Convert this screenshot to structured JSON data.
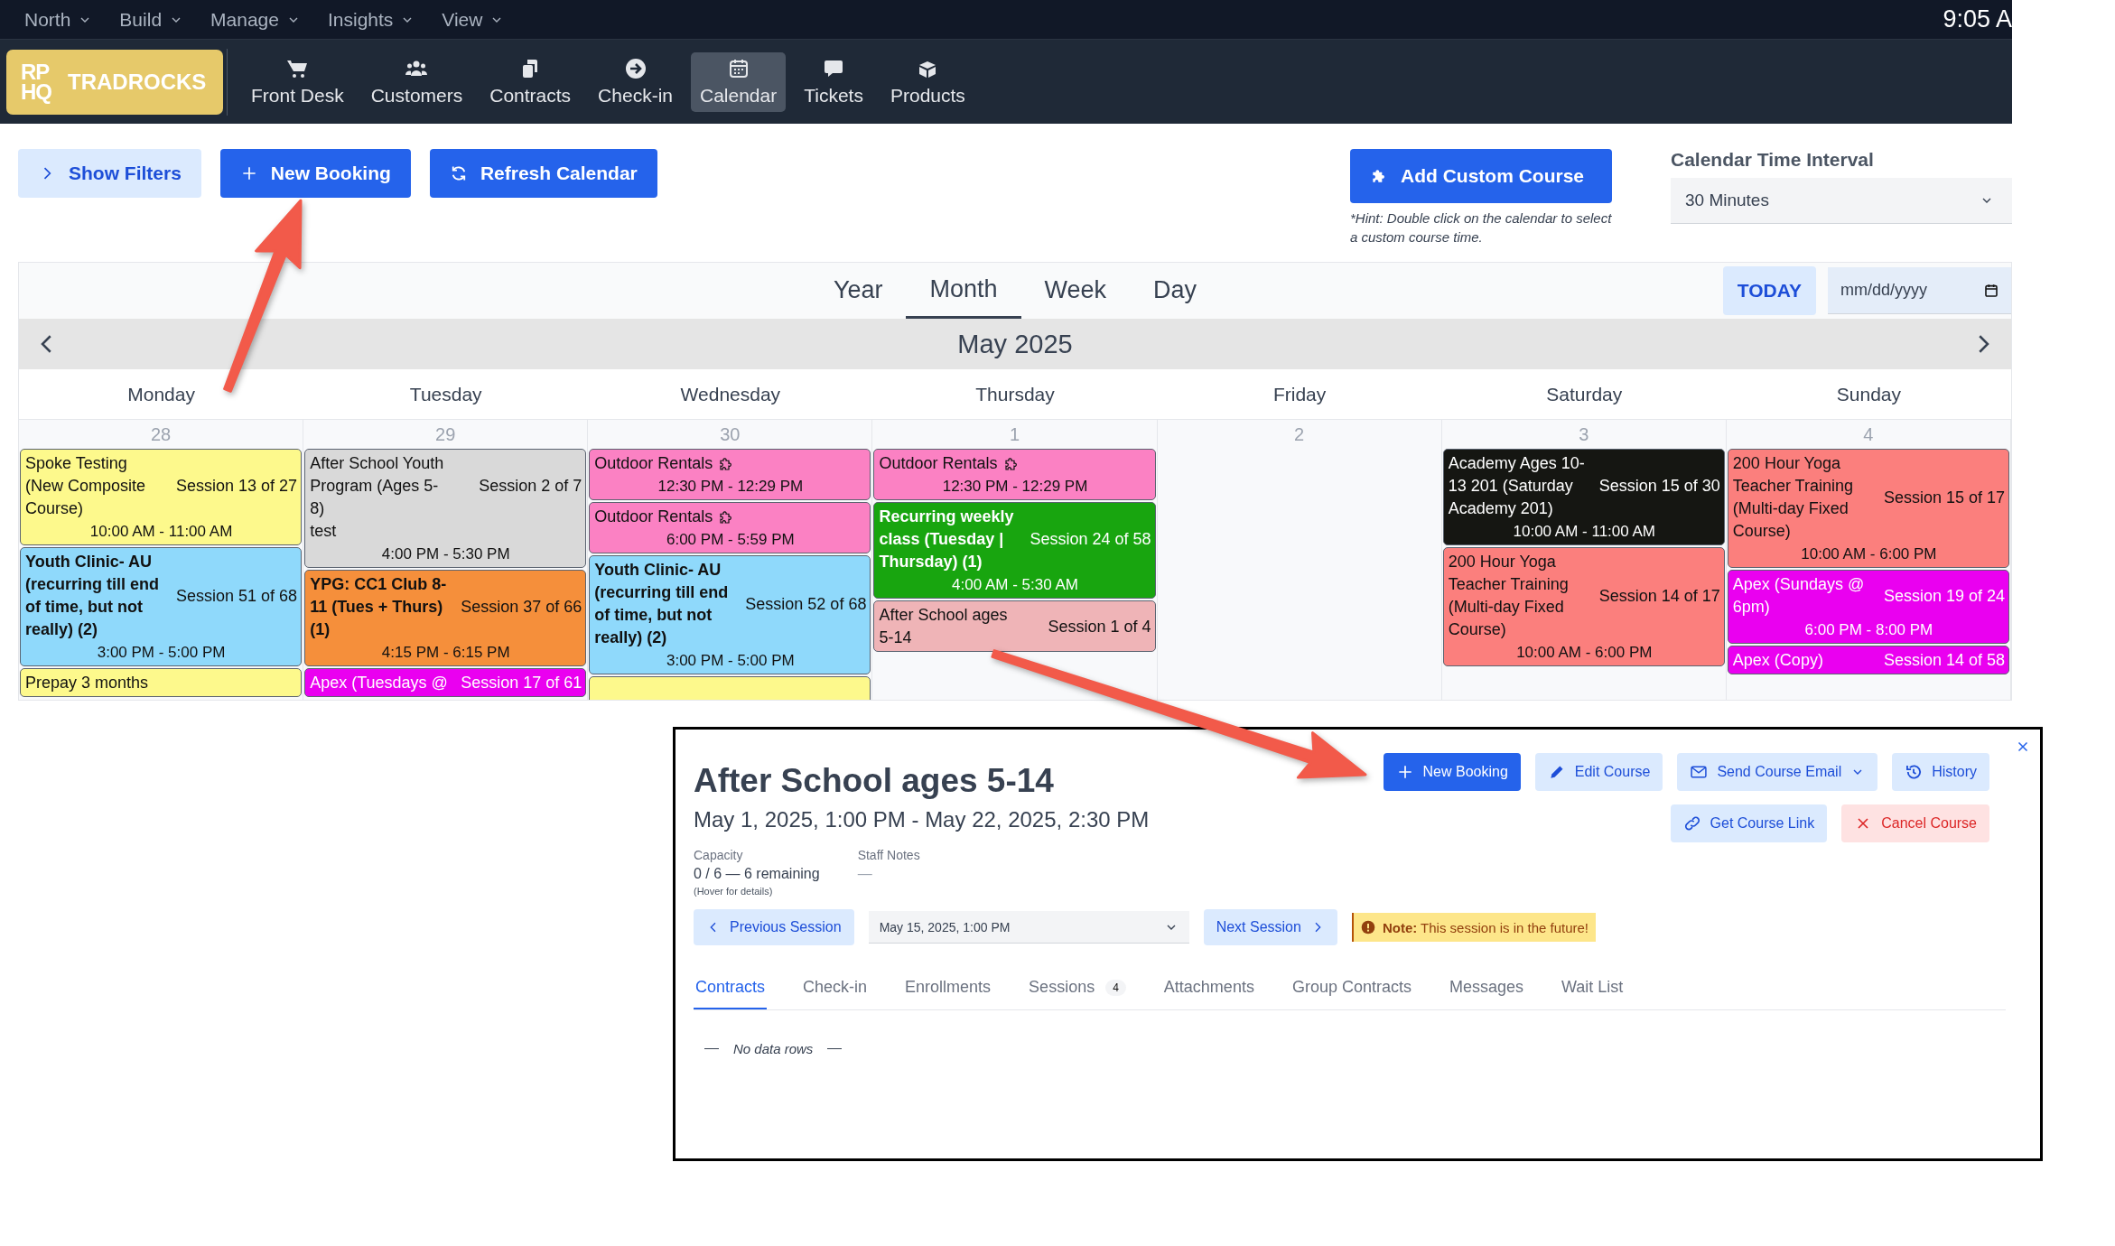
{
  "top_menu": [
    {
      "label": "North"
    },
    {
      "label": "Build"
    },
    {
      "label": "Manage"
    },
    {
      "label": "Insights"
    },
    {
      "label": "View"
    }
  ],
  "clock": "9:05 A",
  "logo": {
    "mark": [
      "RP",
      "HQ"
    ],
    "name": "TRADROCKS"
  },
  "nav": [
    {
      "label": "Front Desk",
      "selected": false
    },
    {
      "label": "Customers",
      "selected": false
    },
    {
      "label": "Contracts",
      "selected": false
    },
    {
      "label": "Check-in",
      "selected": false
    },
    {
      "label": "Calendar",
      "selected": true
    },
    {
      "label": "Tickets",
      "selected": false
    },
    {
      "label": "Products",
      "selected": false
    }
  ],
  "toolbar": {
    "show_filters": "Show Filters",
    "new_booking": "New Booking",
    "refresh": "Refresh Calendar",
    "add_course": "Add Custom Course",
    "hint": "*Hint: Double click on the calendar to select a custom course time.",
    "interval_label": "Calendar Time Interval",
    "interval_value": "30 Minutes"
  },
  "calendar": {
    "views": [
      {
        "label": "Year",
        "selected": false
      },
      {
        "label": "Month",
        "selected": true
      },
      {
        "label": "Week",
        "selected": false
      },
      {
        "label": "Day",
        "selected": false
      }
    ],
    "today": "TODAY",
    "date_placeholder": "mm/dd/yyyy",
    "month": "May 2025",
    "weekdays": [
      "Monday",
      "Tuesday",
      "Wednesday",
      "Thursday",
      "Friday",
      "Saturday",
      "Sunday"
    ],
    "days": [
      {
        "number": "28",
        "events": [
          {
            "kind": "course",
            "title": "Spoke Testing (New Composite Course)",
            "session": "Session 13 of 27",
            "time": "10:00 AM - 11:00 AM",
            "color": "#fdf98c",
            "bold": false
          },
          {
            "kind": "course",
            "title": "Youth Clinic- AU (recurring till end of time, but not really) (2)",
            "session": "Session 51 of 68",
            "time": "3:00 PM - 5:00 PM",
            "color": "#8fd9fb",
            "bold": true
          },
          {
            "kind": "course",
            "title": "Prepay 3 months",
            "color": "#fdf98c",
            "bold": false
          }
        ]
      },
      {
        "number": "29",
        "events": [
          {
            "kind": "course",
            "title": "After School Youth Program (Ages 5-8)",
            "session": "Session 2 of 7",
            "note": "test",
            "time": "4:00 PM - 5:30 PM",
            "color": "#d9d9d9",
            "bold": false
          },
          {
            "kind": "course",
            "title": "YPG: CC1 Club 8-11 (Tues + Thurs) (1)",
            "session": "Session 37 of 66",
            "time": "4:15 PM - 6:15 PM",
            "color": "#f58f3b",
            "bold": true
          },
          {
            "kind": "course",
            "title": "Apex (Tuesdays @",
            "session": "Session 17 of 61",
            "color": "#ea00f0",
            "bold": false
          }
        ]
      },
      {
        "number": "30",
        "events": [
          {
            "kind": "custom",
            "title": "Outdoor Rentals",
            "time": "12:30 PM - 12:29 PM",
            "color": "#fb81c3",
            "bold": false
          },
          {
            "kind": "custom",
            "title": "Outdoor Rentals",
            "time": "6:00 PM - 5:59 PM",
            "color": "#fb81c3",
            "bold": false
          },
          {
            "kind": "course",
            "title": "Youth Clinic- AU (recurring till end of time, but not really) (2)",
            "session": "Session 52 of 68",
            "time": "3:00 PM - 5:00 PM",
            "color": "#8fd9fb",
            "bold": true
          },
          {
            "kind": "course",
            "color": "#fdf98c"
          }
        ]
      },
      {
        "number": "1",
        "events": [
          {
            "kind": "custom",
            "title": "Outdoor Rentals",
            "time": "12:30 PM - 12:29 PM",
            "color": "#fb81c3",
            "bold": false
          },
          {
            "kind": "course",
            "title": "Recurring weekly class (Tuesday | Thursday) (1)",
            "session": "Session 24 of 58",
            "time": "4:00 AM - 5:30 AM",
            "color": "#18a50f",
            "bold": true
          },
          {
            "kind": "course",
            "title": "After School ages 5-14",
            "session": "Session 1 of 4",
            "color": "#efb4b7",
            "bold": false
          }
        ]
      },
      {
        "number": "2"
      },
      {
        "number": "3",
        "events": [
          {
            "kind": "course",
            "title": "Academy Ages 10-13 201 (Saturday Academy 201)",
            "session": "Session 15 of 30",
            "time": "10:00 AM - 11:00 AM",
            "color": "#151612",
            "bold": false
          },
          {
            "kind": "course",
            "title": "200 Hour Yoga Teacher Training (Multi-day Fixed Course)",
            "session": "Session 14 of 17",
            "time": "10:00 AM - 6:00 PM",
            "color": "#fb7f7d",
            "bold": false
          }
        ]
      },
      {
        "number": "4",
        "events": [
          {
            "kind": "course",
            "title": "200 Hour Yoga Teacher Training (Multi-day Fixed Course)",
            "session": "Session 15 of 17",
            "time": "10:00 AM - 6:00 PM",
            "color": "#fb7f7d",
            "bold": false
          },
          {
            "kind": "course",
            "title": "Apex (Sundays @ 6pm)",
            "session": "Session 19 of 24",
            "time": "6:00 PM - 8:00 PM",
            "color": "#ea00f0",
            "bold": false
          },
          {
            "kind": "course",
            "title": "Apex (Copy)",
            "session": "Session 14 of 58",
            "color": "#ea00f0",
            "bold": false
          }
        ]
      }
    ]
  },
  "course_dialog": {
    "title": "After School ages 5-14",
    "date_range": "May 1, 2025, 1:00 PM - May 22, 2025, 2:30 PM",
    "actions": [
      {
        "label": "New Booking",
        "kind": "primary",
        "dropdown": false
      },
      {
        "label": "Edit Course",
        "kind": "secondary",
        "dropdown": false
      },
      {
        "label": "Send Course Email",
        "kind": "secondary",
        "dropdown": true
      },
      {
        "label": "History",
        "kind": "secondary",
        "dropdown": false
      },
      {
        "label": "Get Course Link",
        "kind": "secondary",
        "dropdown": false
      },
      {
        "label": "Cancel Course",
        "kind": "danger",
        "dropdown": false
      }
    ],
    "capacity_label": "Capacity",
    "capacity_value": "0 / 6 — 6 remaining",
    "capacity_hint": "(Hover for details)",
    "staff_notes_label": "Staff Notes",
    "staff_notes_value": "—",
    "previous_session": "Previous Session",
    "session_value": "May 15, 2025, 1:00 PM",
    "next_session": "Next Session",
    "note": "**Note:** This session is in the future!",
    "tabs": [
      {
        "label": "Contracts",
        "selected": true
      },
      {
        "label": "Check-in",
        "selected": false
      },
      {
        "label": "Enrollments",
        "selected": false
      },
      {
        "label": "Sessions",
        "count": "4",
        "selected": false
      },
      {
        "label": "Attachments",
        "selected": false
      },
      {
        "label": "Group Contracts",
        "selected": false
      },
      {
        "label": "Messages",
        "selected": false
      },
      {
        "label": "Wait List",
        "selected": false
      }
    ],
    "empty_text": "No data rows"
  }
}
